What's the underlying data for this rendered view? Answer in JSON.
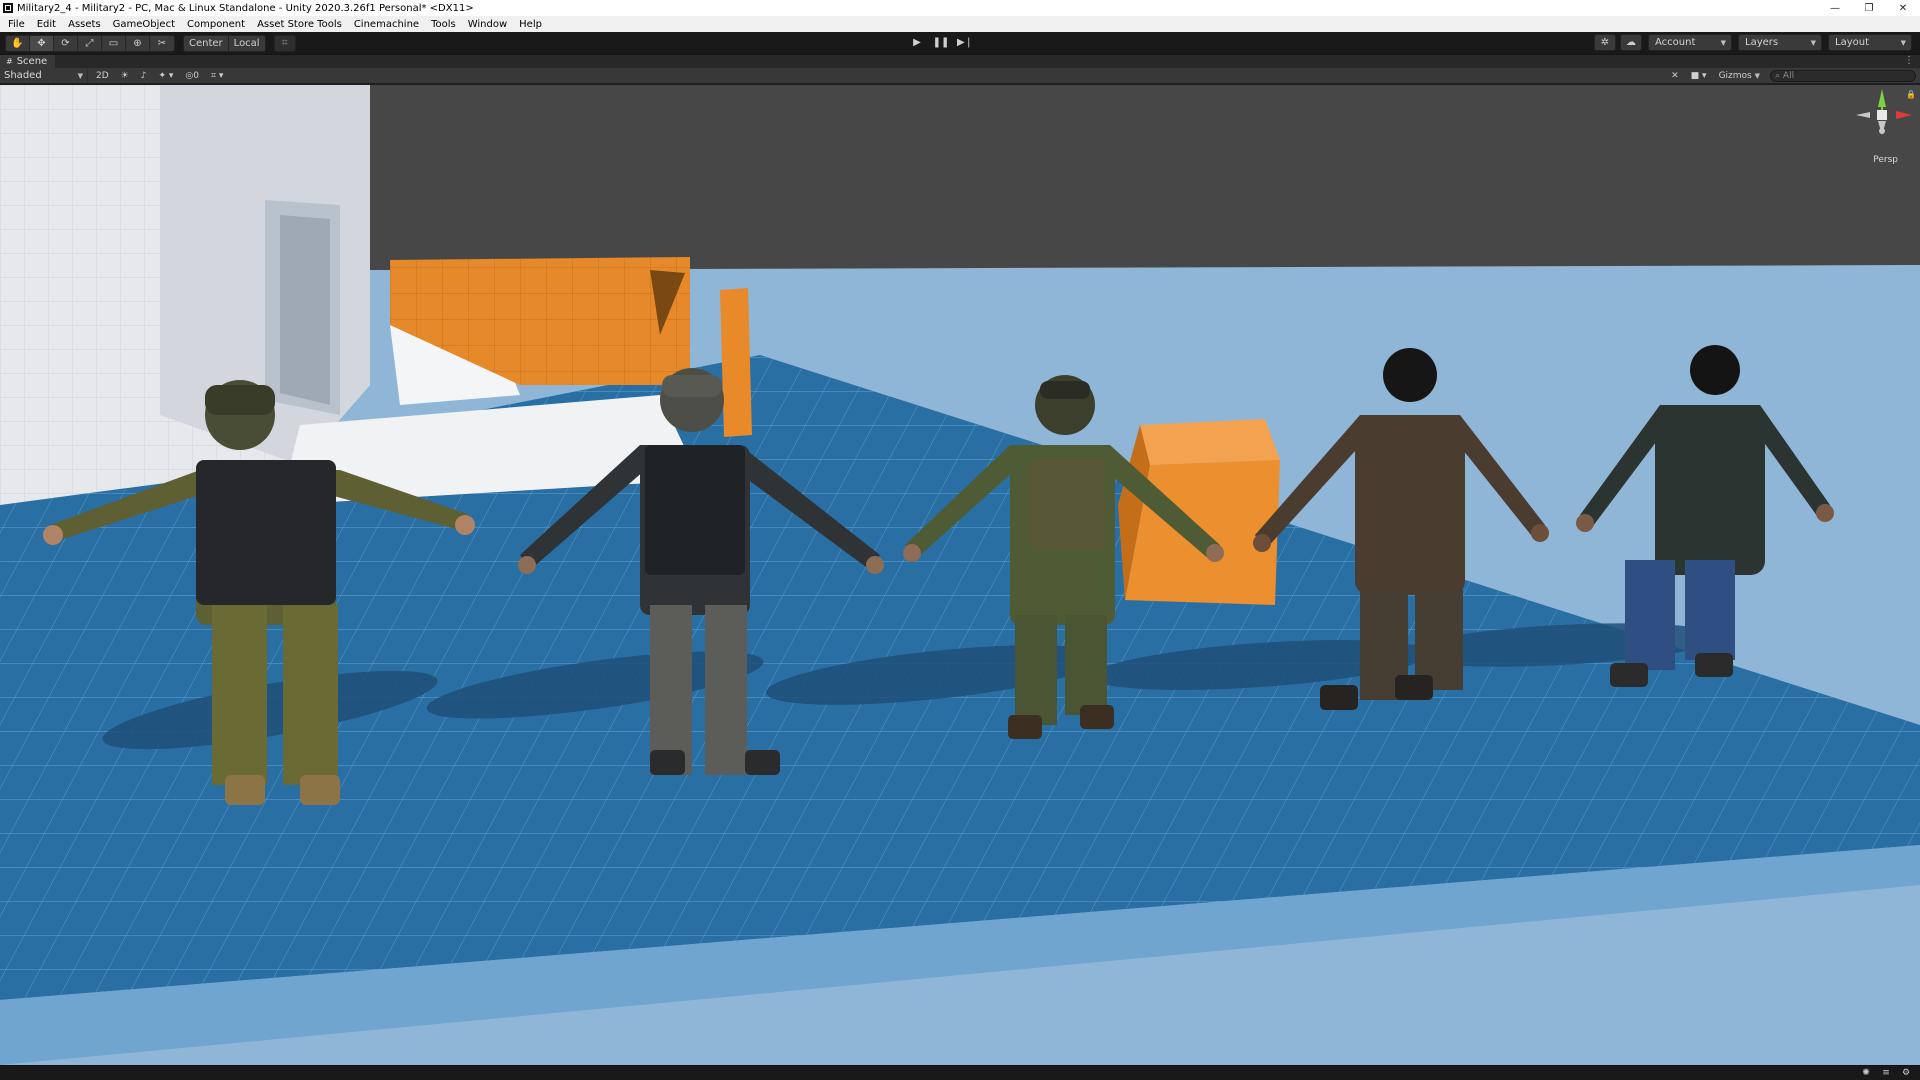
{
  "window": {
    "title": "Military2_4 - Military2 - PC, Mac & Linux Standalone - Unity 2020.3.26f1 Personal* <DX11>",
    "minimize_glyph": "—",
    "restore_glyph": "❐",
    "close_glyph": "✕"
  },
  "menu": {
    "items": [
      "File",
      "Edit",
      "Assets",
      "GameObject",
      "Component",
      "Asset Store Tools",
      "Cinemachine",
      "Tools",
      "Window",
      "Help"
    ]
  },
  "toolbar": {
    "tools": [
      {
        "name": "hand-tool",
        "glyph": "✋"
      },
      {
        "name": "move-tool",
        "glyph": "✥"
      },
      {
        "name": "rotate-tool",
        "glyph": "⟳"
      },
      {
        "name": "scale-tool",
        "glyph": "⤢"
      },
      {
        "name": "rect-tool",
        "glyph": "▭"
      },
      {
        "name": "transform-tool",
        "glyph": "⊕"
      },
      {
        "name": "custom-tool",
        "glyph": "✂"
      }
    ],
    "pivot_label": "Center",
    "space_label": "Local",
    "snap_glyph": "⌗",
    "play_glyph": "▶",
    "pause_glyph": "❚❚",
    "step_glyph": "▶❘",
    "account_label": "Account",
    "layers_label": "Layers",
    "layout_label": "Layout"
  },
  "scene_tab": {
    "label": "Scene",
    "menu_glyph": "⋮"
  },
  "scene_bar": {
    "draw_mode": "Shaded",
    "mode_2d": "2D",
    "hidden_count": "0",
    "gizmos_label": "Gizmos",
    "search_placeholder": "All"
  },
  "viewport": {
    "camera_label": "Persp",
    "gizmo_axes": [
      "y",
      "x"
    ],
    "colors": {
      "sky": "#474747",
      "ground_light": "#8fb6d6",
      "grid_floor": "#2a6fa3",
      "wall": "#e6e8ec",
      "orange": "#e5892a"
    }
  }
}
